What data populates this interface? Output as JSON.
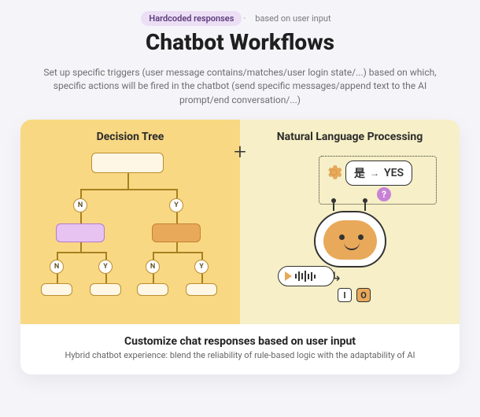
{
  "badge": {
    "hard": "Hardcoded responses",
    "dot": "·",
    "sub": "based on user input"
  },
  "title": "Chatbot Workflows",
  "intro": "Set up specific triggers (user message contains/matches/user login state/...) based on which, specific actions will be fired in the chatbot (send specific messages/append text to the AI prompt/end conversation/...)",
  "diagram": {
    "plus": "+",
    "left_title": "Decision Tree",
    "right_title": "Natural Language Processing",
    "labels": {
      "N": "N",
      "Y": "Y"
    },
    "nlp": {
      "bubble_cjk": "是",
      "bubble_arrow": "→",
      "bubble_yes": "YES",
      "question": "?",
      "io_i": "I",
      "io_o": "O"
    }
  },
  "caption": {
    "title": "Customize chat responses based on user input",
    "sub": "Hybrid chatbot experience: blend the reliability of rule-based logic with the adaptability of AI"
  }
}
